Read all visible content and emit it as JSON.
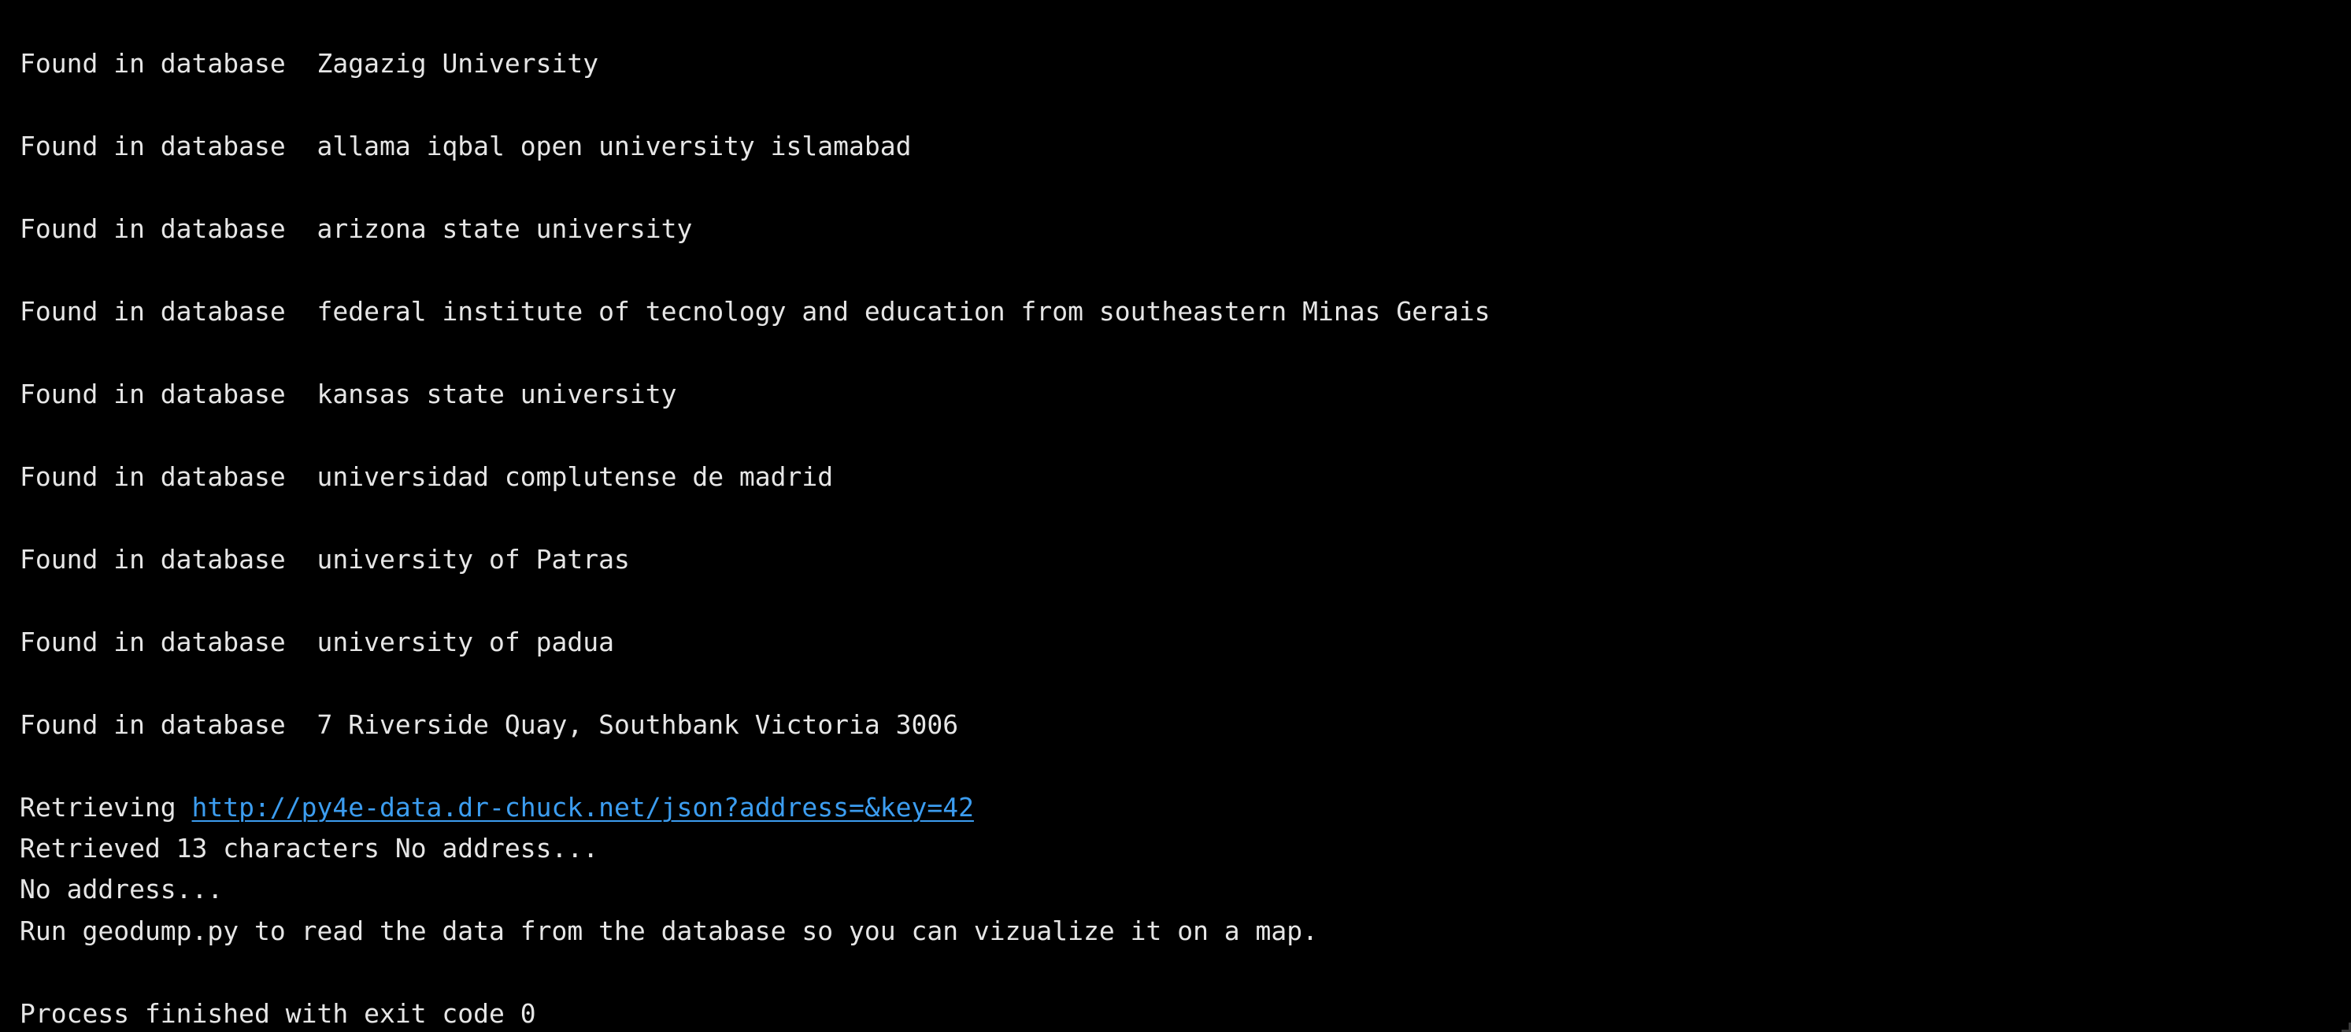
{
  "console": {
    "found_lines": [
      {
        "prefix": "Found in database  ",
        "value": "Zagazig University"
      },
      {
        "prefix": "Found in database  ",
        "value": "allama iqbal open university islamabad"
      },
      {
        "prefix": "Found in database  ",
        "value": "arizona state university"
      },
      {
        "prefix": "Found in database  ",
        "value": "federal institute of tecnology and education from southeastern Minas Gerais"
      },
      {
        "prefix": "Found in database  ",
        "value": "kansas state university"
      },
      {
        "prefix": "Found in database  ",
        "value": "universidad complutense de madrid"
      },
      {
        "prefix": "Found in database  ",
        "value": "university of Patras"
      },
      {
        "prefix": "Found in database  ",
        "value": "university of padua"
      },
      {
        "prefix": "Found in database  ",
        "value": "7 Riverside Quay, Southbank Victoria 3006"
      }
    ],
    "retrieving_prefix": "Retrieving ",
    "retrieving_url": "http://py4e-data.dr-chuck.net/json?address=&key=42",
    "retrieved_line": "Retrieved 13 characters No address...",
    "no_address_line": "No address...",
    "run_line": "Run geodump.py to read the data from the database so you can vizualize it on a map.",
    "exit_line": "Process finished with exit code 0"
  },
  "colors": {
    "background": "#000000",
    "text": "#e6e6e6",
    "link": "#3c9df0"
  }
}
